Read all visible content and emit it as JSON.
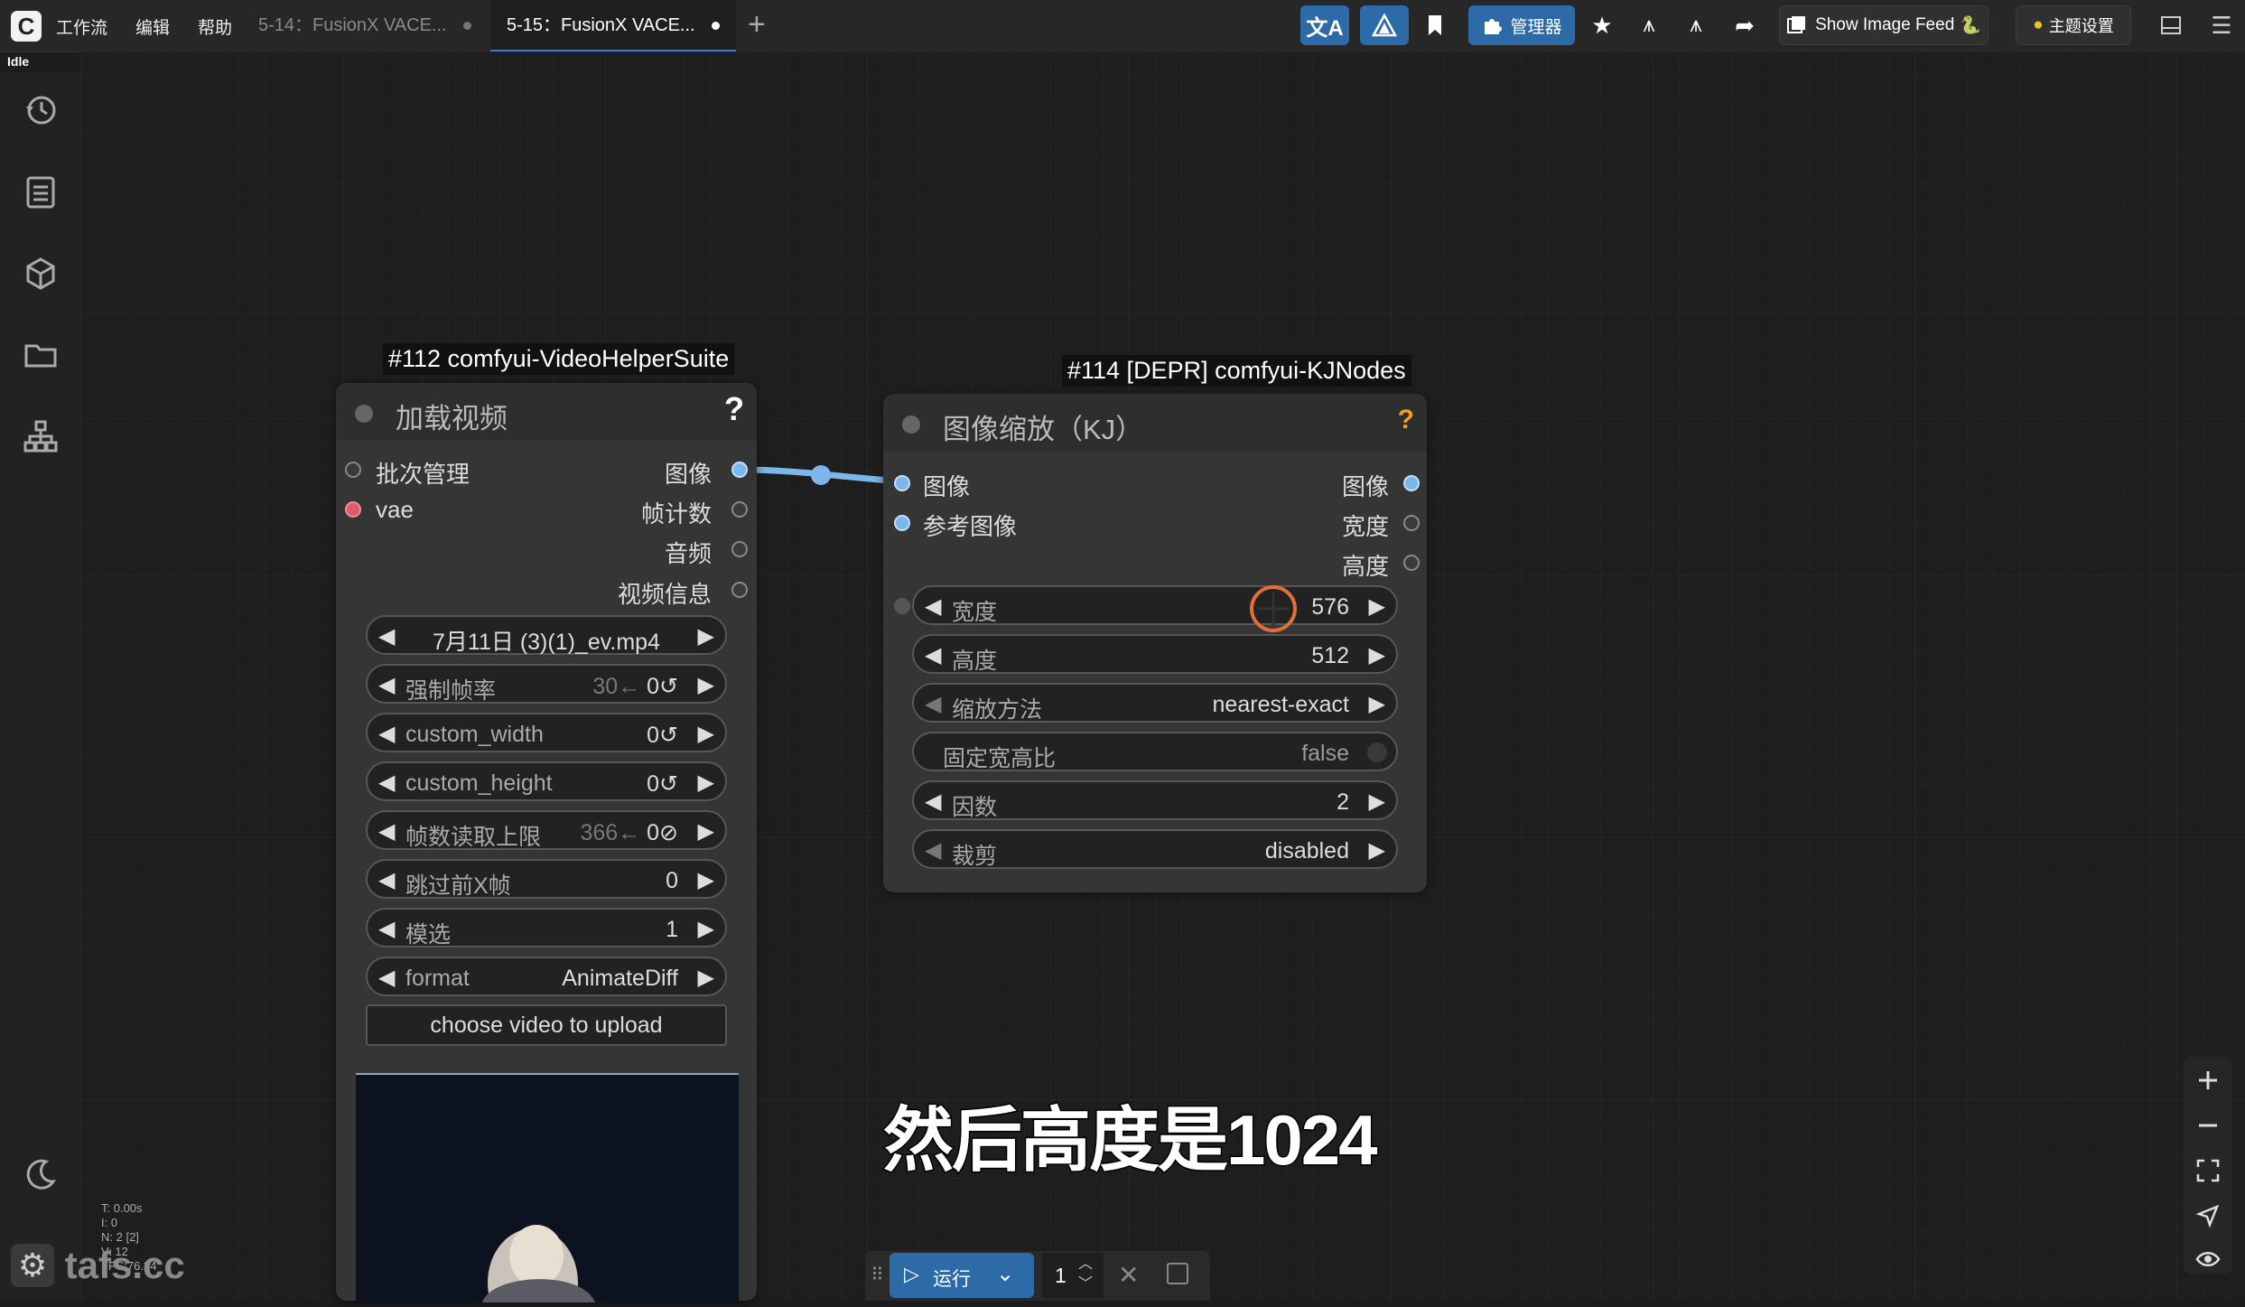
{
  "menu": {
    "workflow": "工作流",
    "edit": "编辑",
    "help": "帮助"
  },
  "tabs": [
    {
      "label": "5-14：FusionX VACE..."
    },
    {
      "label": "5-15：FusionX VACE..."
    }
  ],
  "status": "Idle",
  "toolbar": {
    "manager": "管理器",
    "show_image_feed": "Show Image Feed",
    "theme_settings": "主题设置"
  },
  "node112": {
    "badge": "#112 comfyui-VideoHelperSuite",
    "title": "加载视频",
    "help": "?",
    "inputs": [
      "批次管理",
      "vae"
    ],
    "outputs": [
      "图像",
      "帧计数",
      "音频",
      "视频信息"
    ],
    "widgets": [
      {
        "label": "",
        "value": "7月11日 (3)(1)_ev.mp4"
      },
      {
        "label": "强制帧率",
        "hint": "30←",
        "value": "0↺"
      },
      {
        "label": "custom_width",
        "hint": "",
        "value": "0↺"
      },
      {
        "label": "custom_height",
        "hint": "",
        "value": "0↺"
      },
      {
        "label": "帧数读取上限",
        "hint": "366←",
        "value": "0⊘"
      },
      {
        "label": "跳过前X帧",
        "hint": "",
        "value": "0"
      },
      {
        "label": "模选",
        "hint": "",
        "value": "1"
      },
      {
        "label": "format",
        "hint": "",
        "value": "AnimateDiff"
      }
    ],
    "upload_label": "choose video to upload"
  },
  "node114": {
    "badge": "#114 [DEPR] comfyui-KJNodes",
    "title": "图像缩放（KJ）",
    "help": "?",
    "inputs": [
      "图像",
      "参考图像"
    ],
    "outputs": [
      "图像",
      "宽度",
      "高度"
    ],
    "widgets": [
      {
        "label": "宽度",
        "value": "576"
      },
      {
        "label": "高度",
        "value": "512"
      },
      {
        "label": "缩放方法",
        "value": "nearest-exact"
      },
      {
        "label": "固定宽高比",
        "value": "false"
      },
      {
        "label": "因数",
        "value": "2"
      },
      {
        "label": "裁剪",
        "value": "disabled"
      }
    ]
  },
  "runbar": {
    "run_label": "运行",
    "count": "1"
  },
  "subtitle": "然后高度是1024",
  "stats": [
    "T: 0.00s",
    "I: 0",
    "N: 2 [2]",
    "V: 12",
    "FPS:76.34"
  ],
  "watermark": "tafs.cc",
  "colors": {
    "accent": "#2c6aa8",
    "link": "#7db6ea",
    "required_input": "#e05a6a",
    "help_orange": "#f0a020"
  }
}
